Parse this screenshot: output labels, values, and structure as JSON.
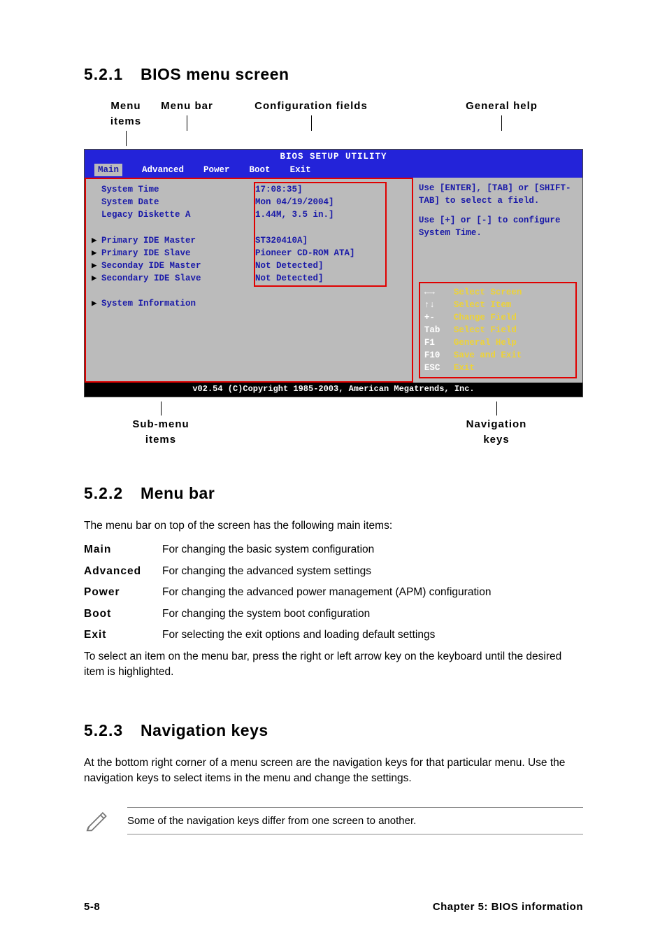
{
  "sections": {
    "s1": {
      "num": "5.2.1",
      "title": "BIOS menu screen"
    },
    "s2": {
      "num": "5.2.2",
      "title": "Menu bar"
    },
    "s3": {
      "num": "5.2.3",
      "title": "Navigation keys"
    }
  },
  "diagram_labels": {
    "menu_items": "Menu items",
    "menu_bar": "Menu bar",
    "config_fields": "Configuration fields",
    "general_help": "General help",
    "submenu_items": "Sub-menu items",
    "nav_keys": "Navigation keys"
  },
  "bios": {
    "title": "BIOS SETUP UTILITY",
    "tabs": {
      "main": "Main",
      "advanced": "Advanced",
      "power": "Power",
      "boot": "Boot",
      "exit": "Exit"
    },
    "rows": [
      {
        "k": "System Time",
        "v": "17:08:35]",
        "arrow": false
      },
      {
        "k": "System Date",
        "v": "Mon 04/19/2004]",
        "arrow": false
      },
      {
        "k": "Legacy Diskette A",
        "v": "1.44M, 3.5 in.]",
        "arrow": false
      },
      {
        "k": "",
        "v": "",
        "arrow": false
      },
      {
        "k": "Primary IDE Master",
        "v": "ST320410A]",
        "arrow": true
      },
      {
        "k": "Primary IDE Slave",
        "v": "Pioneer CD-ROM ATA]",
        "arrow": true
      },
      {
        "k": "Seconday IDE Master",
        "v": "Not Detected]",
        "arrow": true
      },
      {
        "k": "Secondary IDE Slave",
        "v": "Not Detected]",
        "arrow": true
      },
      {
        "k": "",
        "v": "",
        "arrow": false
      },
      {
        "k": "System Information",
        "v": "",
        "arrow": true
      }
    ],
    "help1": "Use [ENTER], [TAB] or [SHIFT-TAB] to select a field.",
    "help2": "Use [+] or [-] to configure System Time.",
    "nav": [
      {
        "key": "←→",
        "lbl": "Select Screen"
      },
      {
        "key": "↑↓",
        "lbl": "Select Item"
      },
      {
        "key": "+-",
        "lbl": "Change Field"
      },
      {
        "key": "Tab",
        "lbl": "Select Field"
      },
      {
        "key": "F1",
        "lbl": "General Help"
      },
      {
        "key": "F10",
        "lbl": "Save and Exit"
      },
      {
        "key": "ESC",
        "lbl": "Exit"
      }
    ],
    "footer": "v02.54 (C)Copyright 1985-2003, American Megatrends, Inc."
  },
  "menubar_section": {
    "intro": "The menu bar on top of the screen has the following main items:",
    "items": [
      {
        "term": "Main",
        "desc": "For changing the basic system configuration"
      },
      {
        "term": "Advanced",
        "desc": "For changing the advanced system settings"
      },
      {
        "term": "Power",
        "desc": "For changing the advanced power management (APM) configuration"
      },
      {
        "term": "Boot",
        "desc": "For changing the system boot configuration"
      },
      {
        "term": "Exit",
        "desc": "For selecting the exit options and loading default settings"
      }
    ],
    "para": "To select an item on the menu bar, press the right or left arrow key on the keyboard until the desired item is highlighted."
  },
  "navkeys_section": {
    "para": "At the bottom right corner of a menu screen are the navigation keys for that particular menu. Use the navigation keys to select items in the menu and change the settings.",
    "note": "Some of the navigation keys differ from one screen to another."
  },
  "pagefoot": {
    "left": "5-8",
    "right": "Chapter 5: BIOS information"
  }
}
